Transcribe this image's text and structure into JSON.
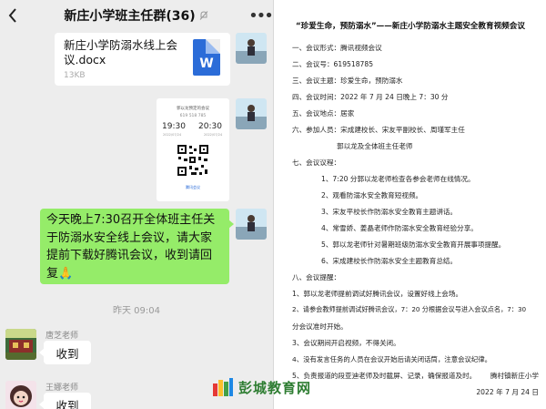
{
  "chat": {
    "title": "新庄小学班主任群(36)",
    "file": {
      "name": "新庄小学防溺水线上会议.docx",
      "size": "13KB",
      "type_letter": "W"
    },
    "meeting_card": {
      "title": "郭以龙预定的会议",
      "number": "619 518 785",
      "start_time": "19:30",
      "end_time": "20:30",
      "start_date": "2022/07/24",
      "end_date": "2022/07/24",
      "brand": "腾讯会议"
    },
    "message": "今天晚上7:30召开全体班主任关于防溺水安全线上会议，请大家提前下载好腾讯会议，收到请回复🙏",
    "timestamp": "昨天 09:04",
    "replies": [
      {
        "sender": "唐芝老师",
        "text": "收到"
      },
      {
        "sender": "王娜老师",
        "text": "收到"
      }
    ]
  },
  "doc": {
    "title": "“珍爱生命，预防溺水”——新庄小学防溺水主题安全教育视频会议",
    "lines": [
      "一、会议形式：腾讯视频会议",
      "二、会议号：619518785",
      "三、会议主题：珍爱生命，预防溺水",
      "四、会议时间：2022 年 7 月 24 日晚上 7：30 分",
      "五、会议地点：居家",
      "六、参加人员：宋成建校长、宋友平副校长、周瑾军主任",
      "郭以龙及全体班主任老师",
      "七、会议议程：",
      "1、7:20 分郭以龙老师检查各参会老师在线情况。",
      "2、观看防溺水安全教育短视频。",
      "3、宋友平校长作防溺水安全教育主题讲话。",
      "4、常雪娇、姜晶老师作防溺水安全教育经验分享。",
      "5、郭以龙老师针对暑期班级防溺水安全教育开展事项提醒。",
      "6、宋成建校长作防溺水安全主题教育总结。",
      "八、会议提醒：",
      "1、郭以龙老师提前调试好腾讯会议，设置好线上会场。",
      "2、请参会教师提前调试好腾讯会议，7：20 分根据会议号进入会议点名，7：30",
      "分会议准时开始。",
      "3、会议期间开启视频，不得关闭。",
      "4、没有发言任务的人员在会议开始后请关闭话筒，注意会议纪律。",
      "5、负责报道的段亚迪老师及时截屏、记录，确保报道及时。"
    ],
    "signature": "腾村镇新庄小学",
    "date": "2022 年 7 月 24 日"
  },
  "watermark": {
    "text": "彭城教育网"
  }
}
